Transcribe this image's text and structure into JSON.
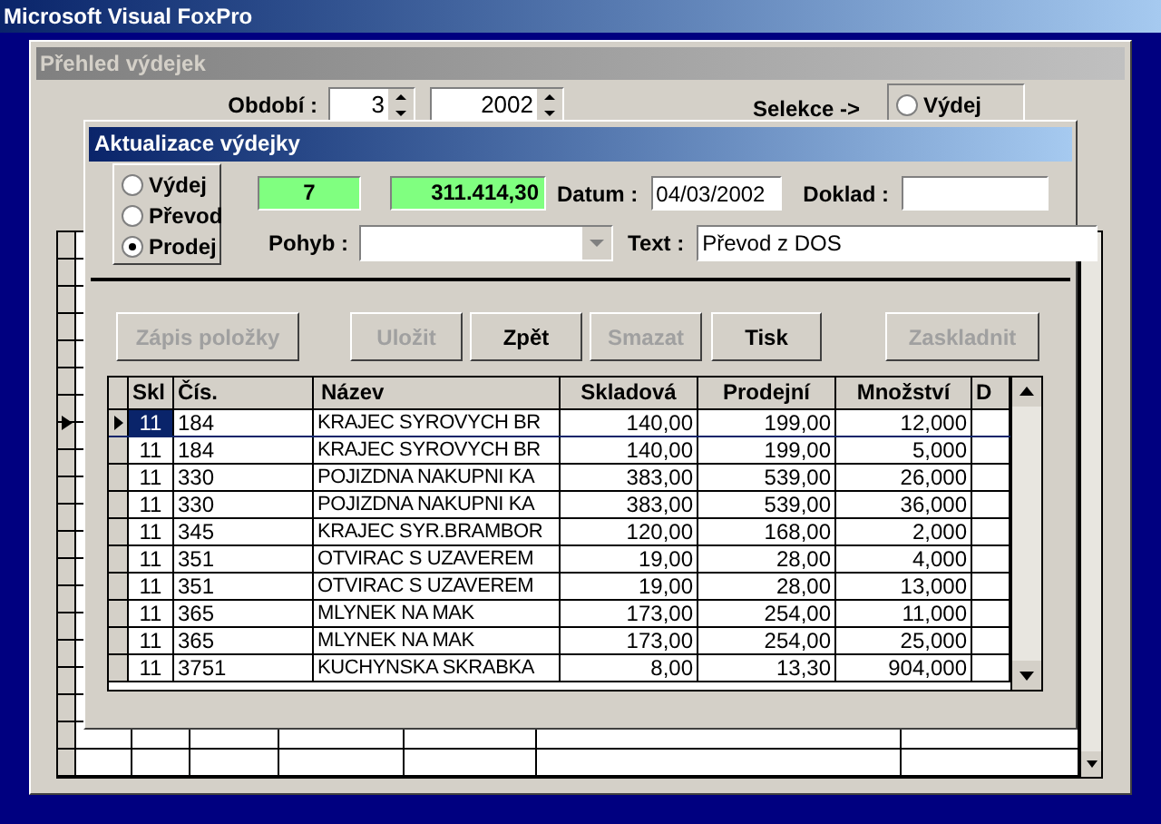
{
  "app": {
    "title": "Microsoft Visual FoxPro"
  },
  "back_window": {
    "title": "Přehled výdejek",
    "period_label": "Období :",
    "month": "3",
    "year": "2002",
    "selection_label": "Selekce ->",
    "radio": {
      "label": "Výdej",
      "selected": false
    }
  },
  "dialog": {
    "title": "Aktualizace výdejky",
    "types": [
      {
        "label": "Výdej",
        "selected": false
      },
      {
        "label": "Převod",
        "selected": false
      },
      {
        "label": "Prodej",
        "selected": true
      }
    ],
    "count": "7",
    "total": "311.414,30",
    "date_label": "Datum :",
    "date": "04/03/2002",
    "document_label": "Doklad :",
    "movement_label": "Pohyb :",
    "text_label": "Text :",
    "text": "Převod z DOS",
    "buttons": [
      {
        "label": "Zápis položky",
        "disabled": true
      },
      {
        "label": "Uložit",
        "disabled": true
      },
      {
        "label": "Zpět",
        "disabled": false
      },
      {
        "label": "Smazat",
        "disabled": true
      },
      {
        "label": "Tisk",
        "disabled": false
      },
      {
        "label": "Zaskladnit",
        "disabled": true
      }
    ],
    "table": {
      "columns": [
        "Skl",
        "Čís.",
        "Název",
        "Skladová",
        "Prodejní",
        "Množství",
        "D"
      ],
      "rows": [
        {
          "current": true,
          "cells": [
            "11",
            "184",
            "KRAJEC SYROVYCH BR",
            "140,00",
            "199,00",
            "12,000"
          ]
        },
        {
          "current": false,
          "cells": [
            "11",
            "184",
            "KRAJEC SYROVYCH BR",
            "140,00",
            "199,00",
            "5,000"
          ]
        },
        {
          "current": false,
          "cells": [
            "11",
            "330",
            "POJIZDNA NAKUPNI KA",
            "383,00",
            "539,00",
            "26,000"
          ]
        },
        {
          "current": false,
          "cells": [
            "11",
            "330",
            "POJIZDNA NAKUPNI KA",
            "383,00",
            "539,00",
            "36,000"
          ]
        },
        {
          "current": false,
          "cells": [
            "11",
            "345",
            "KRAJEC SYR.BRAMBOR",
            "120,00",
            "168,00",
            "2,000"
          ]
        },
        {
          "current": false,
          "cells": [
            "11",
            "351",
            "OTVIRAC S UZAVEREM",
            "19,00",
            "28,00",
            "4,000"
          ]
        },
        {
          "current": false,
          "cells": [
            "11",
            "351",
            "OTVIRAC S UZAVEREM",
            "19,00",
            "28,00",
            "13,000"
          ]
        },
        {
          "current": false,
          "cells": [
            "11",
            "365",
            "MLYNEK NA MAK",
            "173,00",
            "254,00",
            "11,000"
          ]
        },
        {
          "current": false,
          "cells": [
            "11",
            "365",
            "MLYNEK NA MAK",
            "173,00",
            "254,00",
            "25,000"
          ]
        },
        {
          "current": false,
          "cells": [
            "11",
            "3751",
            "KUCHYNSKA SKRABKA",
            "8,00",
            "13,30",
            "904,000"
          ]
        }
      ]
    }
  }
}
